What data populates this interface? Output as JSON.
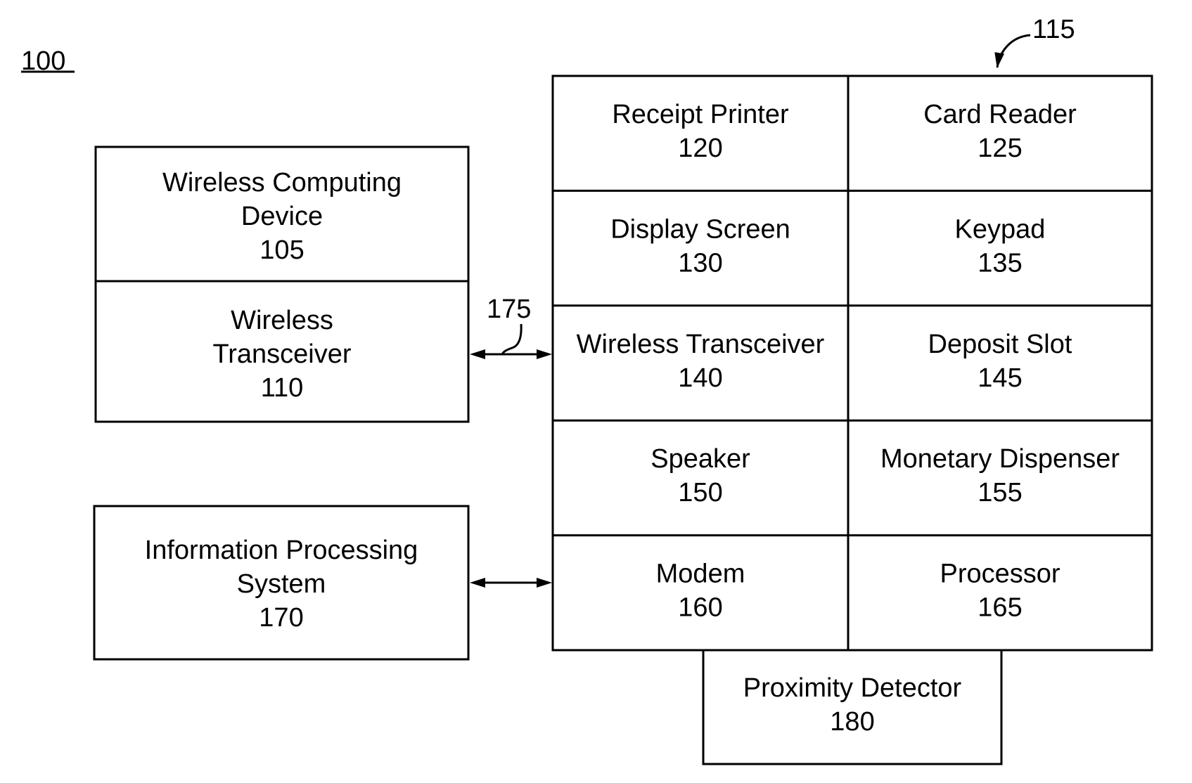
{
  "figure": {
    "system_ref": "100",
    "atm_ref": "115",
    "link_ref": "175"
  },
  "wireless_device": {
    "title_lines": [
      "Wireless Computing",
      "Device",
      "105"
    ],
    "transceiver_lines": [
      "Wireless",
      "Transceiver",
      "110"
    ]
  },
  "info_system": {
    "lines": [
      "Information Processing",
      "System",
      "170"
    ]
  },
  "atm_components": [
    {
      "name": "Receipt Printer",
      "ref": "120"
    },
    {
      "name": "Card Reader",
      "ref": "125"
    },
    {
      "name": "Display Screen",
      "ref": "130"
    },
    {
      "name": "Keypad",
      "ref": "135"
    },
    {
      "name": "Wireless Transceiver",
      "ref": "140"
    },
    {
      "name": "Deposit Slot",
      "ref": "145"
    },
    {
      "name": "Speaker",
      "ref": "150"
    },
    {
      "name": "Monetary Dispenser",
      "ref": "155"
    },
    {
      "name": "Modem",
      "ref": "160"
    },
    {
      "name": "Processor",
      "ref": "165"
    }
  ],
  "proximity_detector": {
    "name": "Proximity Detector",
    "ref": "180"
  },
  "connections": [
    {
      "from": "Wireless Transceiver 110",
      "to": "Wireless Transceiver 140",
      "label": "175",
      "bidirectional": true
    },
    {
      "from": "Information Processing System 170",
      "to": "Modem 160",
      "bidirectional": true
    }
  ]
}
